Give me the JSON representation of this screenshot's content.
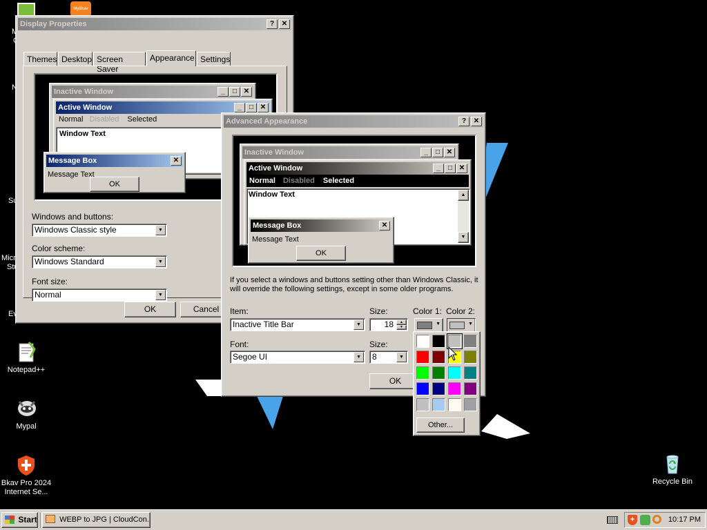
{
  "desktop": {
    "icons": [
      {
        "name": "notepadpp",
        "label": "Notepad++"
      },
      {
        "name": "mypal",
        "label": "Mypal"
      },
      {
        "name": "bkav",
        "label": "Bkav Pro 2024 Internet Se..."
      },
      {
        "name": "recycle",
        "label": "Recycle Bin"
      }
    ],
    "clipped_labels": [
      "M",
      "C",
      "N",
      "Su",
      "Micro",
      "Stu",
      "Ev"
    ],
    "mybkav_label": "MyBkav"
  },
  "display_properties": {
    "title": "Display Properties",
    "tabs": [
      "Themes",
      "Desktop",
      "Screen Saver",
      "Appearance",
      "Settings"
    ],
    "selected_tab": "Appearance",
    "preview": {
      "inactive_title": "Inactive Window",
      "active_title": "Active Window",
      "menu": [
        "Normal",
        "Disabled",
        "Selected"
      ],
      "window_text": "Window Text",
      "msgbox_title": "Message Box",
      "msgbox_text": "Message Text",
      "ok": "OK"
    },
    "windows_buttons_label": "Windows and buttons:",
    "windows_buttons_value": "Windows Classic style",
    "color_scheme_label": "Color scheme:",
    "color_scheme_value": "Windows Standard",
    "font_size_label": "Font size:",
    "font_size_value": "Normal",
    "ok": "OK",
    "cancel": "Cancel"
  },
  "advanced_appearance": {
    "title": "Advanced Appearance",
    "preview": {
      "inactive_title": "Inactive Window",
      "active_title": "Active Window",
      "menu": [
        "Normal",
        "Disabled",
        "Selected"
      ],
      "window_text": "Window Text",
      "msgbox_title": "Message Box",
      "msgbox_text": "Message Text",
      "ok": "OK"
    },
    "info_text": "If you select a windows and buttons setting other than Windows Classic, it will override the following settings, except in some older programs.",
    "item_label": "Item:",
    "item_value": "Inactive Title Bar",
    "size_label": "Size:",
    "size_value": "18",
    "color1_label": "Color 1:",
    "color2_label": "Color 2:",
    "font_label": "Font:",
    "font_value": "Segoe UI",
    "font_size_label": "Size:",
    "font_size_value": "8",
    "ok": "OK",
    "color1": "#808080",
    "color2": "#c0c0c0"
  },
  "color_picker": {
    "colors": [
      "#ffffff",
      "#000000",
      "#c0c0c0",
      "#808080",
      "#ff0000",
      "#800000",
      "#ffff00",
      "#808000",
      "#00ff00",
      "#008000",
      "#00ffff",
      "#008080",
      "#0000ff",
      "#000080",
      "#ff00ff",
      "#800080",
      "#c0c0c0",
      "#a6caf0",
      "#fffbf0",
      "#a0a0a4"
    ],
    "other": "Other..."
  },
  "taskbar": {
    "start": "Start",
    "task": "WEBP to JPG | CloudCon...",
    "clock": "10:17 PM"
  }
}
